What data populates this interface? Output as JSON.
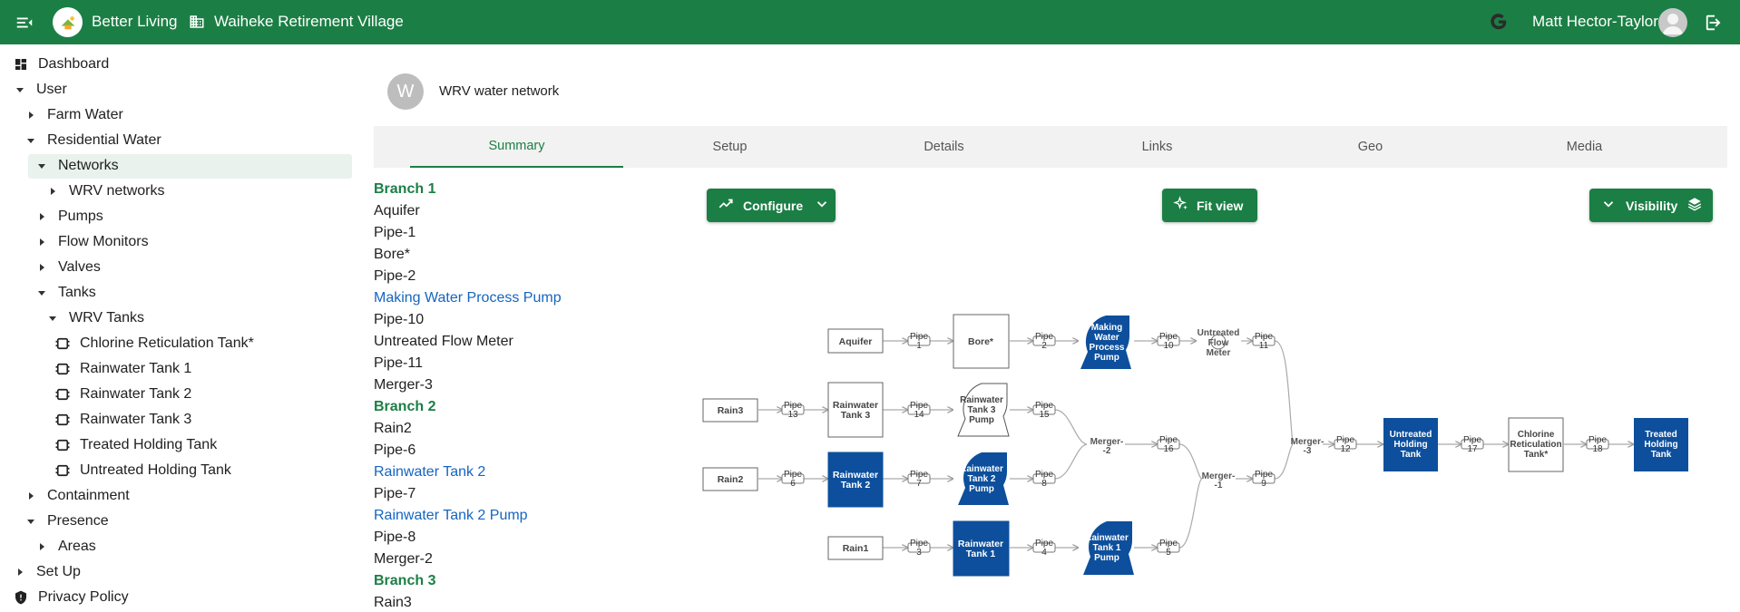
{
  "header": {
    "app_name": "Better Living",
    "site_name": "Waiheke Retirement Village",
    "user_name": "Matt Hector-Taylor",
    "brand_color": "#1b7f45"
  },
  "sidebar": {
    "dashboard": "Dashboard",
    "user": "User",
    "farm_water": "Farm Water",
    "residential_water": "Residential Water",
    "networks": "Networks",
    "wrv_networks": "WRV networks",
    "pumps": "Pumps",
    "flow_monitors": "Flow Monitors",
    "valves": "Valves",
    "tanks": "Tanks",
    "wrv_tanks": "WRV Tanks",
    "tank_items": [
      "Chlorine Reticulation Tank*",
      "Rainwater Tank 1",
      "Rainwater Tank 2",
      "Rainwater Tank 3",
      "Treated Holding Tank",
      "Untreated Holding Tank"
    ],
    "containment": "Containment",
    "presence": "Presence",
    "areas": "Areas",
    "set_up": "Set Up",
    "privacy_policy": "Privacy Policy"
  },
  "page": {
    "avatar_letter": "W",
    "title": "WRV water network"
  },
  "tabs": [
    "Summary",
    "Setup",
    "Details",
    "Links",
    "Geo",
    "Media"
  ],
  "active_tab": "Summary",
  "summary_list": [
    {
      "text": "Branch 1",
      "kind": "branch"
    },
    {
      "text": "Aquifer",
      "kind": "plain"
    },
    {
      "text": "Pipe-1",
      "kind": "plain"
    },
    {
      "text": "Bore*",
      "kind": "plain"
    },
    {
      "text": "Pipe-2",
      "kind": "plain"
    },
    {
      "text": "Making Water Process Pump",
      "kind": "link"
    },
    {
      "text": "Pipe-10",
      "kind": "plain"
    },
    {
      "text": "Untreated Flow Meter",
      "kind": "plain"
    },
    {
      "text": "Pipe-11",
      "kind": "plain"
    },
    {
      "text": "Merger-3",
      "kind": "plain"
    },
    {
      "text": "Branch 2",
      "kind": "branch"
    },
    {
      "text": "Rain2",
      "kind": "plain"
    },
    {
      "text": "Pipe-6",
      "kind": "plain"
    },
    {
      "text": "Rainwater Tank 2",
      "kind": "link"
    },
    {
      "text": "Pipe-7",
      "kind": "plain"
    },
    {
      "text": "Rainwater Tank 2 Pump",
      "kind": "link"
    },
    {
      "text": "Pipe-8",
      "kind": "plain"
    },
    {
      "text": "Merger-2",
      "kind": "plain"
    },
    {
      "text": "Branch 3",
      "kind": "branch"
    },
    {
      "text": "Rain3",
      "kind": "plain"
    }
  ],
  "toolbar": {
    "configure": "Configure",
    "fit_view": "Fit view",
    "visibility": "Visibility"
  },
  "diagram": {
    "aquifer": "Aquifer",
    "bore": "Bore*",
    "making_pump": [
      "Making",
      "Water",
      "Process",
      "Pump"
    ],
    "untreated_flow_meter": [
      "Untreated",
      "Flow",
      "Meter"
    ],
    "rain3": "Rain3",
    "rain2": "Rain2",
    "rain1": "Rain1",
    "rainwater_tank_3": [
      "Rainwater",
      "Tank 3"
    ],
    "rainwater_tank_2": [
      "Rainwater",
      "Tank 2"
    ],
    "rainwater_tank_1": [
      "Rainwater",
      "Tank 1"
    ],
    "rt3_pump": [
      "Rainwater",
      "Tank 3",
      "Pump"
    ],
    "rt2_pump": [
      "Rainwater",
      "Tank 2",
      "Pump"
    ],
    "rt1_pump": [
      "Rainwater",
      "Tank 1",
      "Pump"
    ],
    "merger_1": [
      "Merger-",
      "-1"
    ],
    "merger_2": [
      "Merger-",
      "-2"
    ],
    "merger_3": [
      "Merger-",
      "-3"
    ],
    "untreated_holding_tank": [
      "Untreated",
      "Holding",
      "Tank"
    ],
    "chlorine_tank": [
      "Chlorine",
      "Reticulation",
      "Tank*"
    ],
    "treated_holding_tank": [
      "Treated",
      "Holding",
      "Tank"
    ],
    "pipes": {
      "p1": [
        "Pipe",
        "1"
      ],
      "p2": [
        "Pipe",
        "2"
      ],
      "p3": [
        "Pipe",
        "3"
      ],
      "p4": [
        "Pipe",
        "4"
      ],
      "p5": [
        "Pipe",
        "5"
      ],
      "p6": [
        "Pipe",
        "6"
      ],
      "p7": [
        "Pipe",
        "7"
      ],
      "p8": [
        "Pipe",
        "8"
      ],
      "p9": [
        "Pipe",
        "9"
      ],
      "p10": [
        "Pipe",
        "10"
      ],
      "p11": [
        "Pipe",
        "11"
      ],
      "p12": [
        "Pipe",
        "12"
      ],
      "p13": [
        "Pipe",
        "13"
      ],
      "p14": [
        "Pipe",
        "14"
      ],
      "p15": [
        "Pipe",
        "15"
      ],
      "p16": [
        "Pipe",
        "16"
      ],
      "p17": [
        "Pipe",
        "17"
      ],
      "p18": [
        "Pipe",
        "18"
      ]
    },
    "highlight_color": "#0d4f9c"
  }
}
